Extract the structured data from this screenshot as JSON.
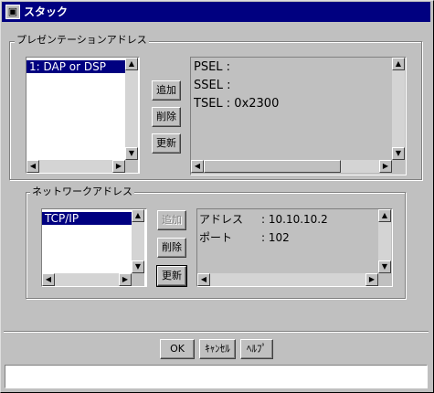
{
  "window": {
    "title": "スタック",
    "icon": "app-window-icon"
  },
  "presentation": {
    "legend": "プレゼンテーションアドレス",
    "list_items": [
      "1: DAP or DSP"
    ],
    "buttons": {
      "add": "追加",
      "delete": "削除",
      "update": "更新"
    },
    "details": [
      "PSEL :",
      "SSEL :",
      "TSEL : 0x2300"
    ]
  },
  "network": {
    "legend": "ネットワークアドレス",
    "list_items": [
      "TCP/IP"
    ],
    "buttons": {
      "add": "追加",
      "delete": "削除",
      "update": "更新"
    },
    "details": [
      {
        "label": "アドレス",
        "value": ": 10.10.10.2"
      },
      {
        "label": "ポート",
        "value": ": 102"
      }
    ]
  },
  "footer": {
    "ok": "OK",
    "cancel": "ｷｬﾝｾﾙ",
    "help": "ﾍﾙﾌﾟ",
    "status": ""
  },
  "icons": {
    "up": "scroll-up-arrow-icon",
    "down": "scroll-down-arrow-icon",
    "left": "scroll-left-arrow-icon",
    "right": "scroll-right-arrow-icon"
  },
  "colors": {
    "title_bar": "#000080",
    "selection": "#000080",
    "face": "#c0c0c0"
  }
}
